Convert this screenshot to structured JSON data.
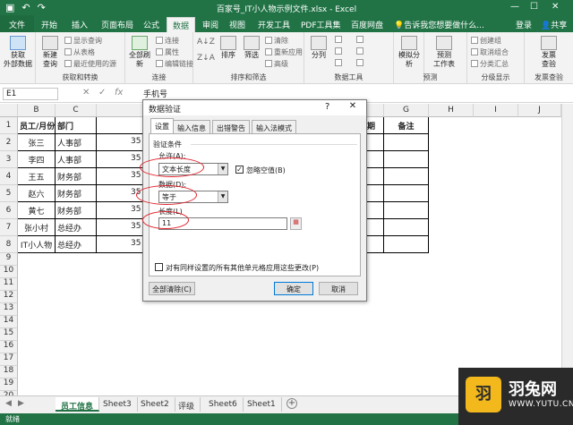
{
  "titlebar": {
    "title": "百家号_IT小人物示例文件.xlsx - Excel",
    "min": "—",
    "max": "☐",
    "close": "✕"
  },
  "tabs": {
    "file": "文件",
    "items": [
      "开始",
      "插入",
      "页面布局",
      "公式",
      "数据",
      "审阅",
      "视图",
      "开发工具",
      "PDF工具集",
      "百度网盘"
    ],
    "tell": "告诉我您想要做什么...",
    "login": "登录",
    "share": "共享"
  },
  "ribbon": {
    "get_external": "获取\n外部数据",
    "new_query": "新建\n查询",
    "show_queries": "显示查询",
    "from_table": "从表格",
    "recent_sources": "最近使用的源",
    "group1": "获取和转换",
    "refresh_all": "全部刷新",
    "connections": "连接",
    "properties": "属性",
    "edit_links": "编辑链接",
    "group2": "连接",
    "sort": "排序",
    "filter": "筛选",
    "clear": "清除",
    "reapply": "重新应用",
    "advanced": "高级",
    "group3": "排序和筛选",
    "text_to_columns": "分列",
    "group4": "数据工具",
    "what_if": "模拟分析",
    "forecast_sheet": "预测\n工作表",
    "group5": "预测",
    "create_group": "创建组",
    "ungroup": "取消组合",
    "subtotal": "分类汇总",
    "group6": "分级显示",
    "send_check": "发票\n查验",
    "group7": "发票查验"
  },
  "formula_bar": {
    "name_box": "E1",
    "cancel": "✕",
    "enter": "✓",
    "fx": "fx",
    "content": "手机号"
  },
  "grid": {
    "columns": [
      "B",
      "C",
      "D",
      "E",
      "F",
      "G",
      "H",
      "I",
      "J"
    ],
    "rows": [
      "1",
      "2",
      "3",
      "4",
      "5",
      "6",
      "7",
      "8",
      "9",
      "10",
      "11",
      "12",
      "13",
      "14",
      "15",
      "16",
      "17",
      "18",
      "19",
      "20",
      "21"
    ],
    "header_b": "员工/月份",
    "header_c": "部门",
    "header_f": "期",
    "header_g": "备注",
    "data": [
      {
        "name": "张三",
        "dept": "人事部",
        "phone": "35"
      },
      {
        "name": "李四",
        "dept": "人事部",
        "phone": "35"
      },
      {
        "name": "王五",
        "dept": "财务部",
        "phone": "35"
      },
      {
        "name": "赵六",
        "dept": "财务部",
        "phone": "35"
      },
      {
        "name": "黄七",
        "dept": "财务部",
        "phone": "35"
      },
      {
        "name": "张小村",
        "dept": "总经办",
        "phone": "35"
      },
      {
        "name": "IT小人物",
        "dept": "总经办",
        "phone": "35"
      }
    ]
  },
  "dialog": {
    "title": "数据验证",
    "help": "?",
    "close": "✕",
    "tabs": [
      "设置",
      "输入信息",
      "出错警告",
      "输入法模式"
    ],
    "criteria_label": "验证条件",
    "allow_label": "允许(A):",
    "allow_value": "文本长度",
    "ignore_blank": "忽略空值(B)",
    "data_label": "数据(D):",
    "data_value": "等于",
    "length_label": "长度(L)",
    "length_value": "11",
    "apply_all": "对有同样设置的所有其他单元格应用这些更改(P)",
    "clear_all": "全部清除(C)",
    "ok": "确定",
    "cancel": "取消"
  },
  "sheets": [
    "员工信息",
    "Sheet3",
    "Sheet2",
    "评级",
    "Sheet6",
    "Sheet1"
  ],
  "statusbar": {
    "text": "就绪"
  },
  "watermark": {
    "name": "羽兔网",
    "url": "WWW.YUTU.CN",
    "logo": "羽"
  }
}
